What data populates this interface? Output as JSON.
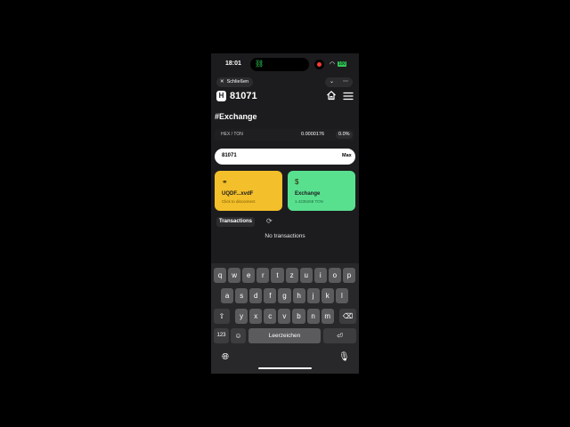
{
  "status_bar": {
    "time": "18:01",
    "battery": "100"
  },
  "topbar": {
    "close_label": "Schließen",
    "chevron": "⌄",
    "more": "⋯"
  },
  "header": {
    "logo_letter": "H",
    "balance": "81071"
  },
  "page": {
    "heading": "#Exchange"
  },
  "pair": {
    "label": "HEX / TON",
    "price": "0.0000176",
    "change": "0.0%"
  },
  "amount": {
    "value": "81071",
    "max_label": "Max"
  },
  "cards": {
    "wallet": {
      "icon": "wallet-connect-icon",
      "title": "UQDF...xvdF",
      "subtitle": "Click to disconnect"
    },
    "exchange": {
      "icon_glyph": "$",
      "title": "Exchange",
      "subtitle": "1.4235268 TON"
    }
  },
  "transactions": {
    "label": "Transactions",
    "empty": "No transactions"
  },
  "keyboard": {
    "row1": [
      "q",
      "w",
      "e",
      "r",
      "t",
      "z",
      "u",
      "i",
      "o",
      "p"
    ],
    "row2": [
      "a",
      "s",
      "d",
      "f",
      "g",
      "h",
      "j",
      "k",
      "l"
    ],
    "row3": [
      "y",
      "x",
      "c",
      "v",
      "b",
      "n",
      "m"
    ],
    "numbers_label": "123",
    "space_label": "Leerzeichen",
    "return_glyph": "⏎",
    "shift_glyph": "⇧",
    "backspace_glyph": "⌫",
    "emoji_glyph": "☺"
  },
  "colors": {
    "wallet_card": "#f3bf2a",
    "exchange_card": "#59e08f",
    "background": "#1c1c1e"
  }
}
